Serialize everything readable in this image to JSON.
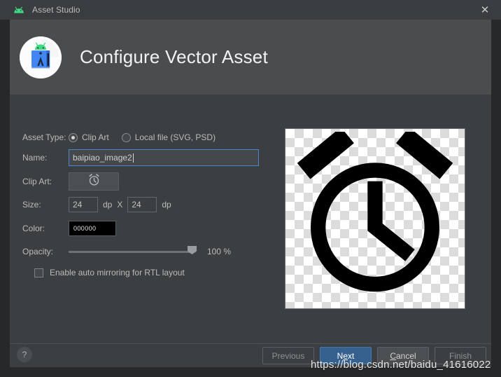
{
  "window": {
    "title": "Asset Studio",
    "app_icon": "android-head-icon",
    "close_icon": "close-icon"
  },
  "header": {
    "logo_icon": "android-studio-asset-icon",
    "title": "Configure Vector Asset"
  },
  "form": {
    "asset_type": {
      "label": "Asset Type:",
      "options": [
        {
          "label": "Clip Art",
          "selected": true
        },
        {
          "label": "Local file (SVG, PSD)",
          "selected": false
        }
      ]
    },
    "name": {
      "label": "Name:",
      "value": "baipiao_image2",
      "placeholder": ""
    },
    "clip_art": {
      "label": "Clip Art:",
      "icon": "alarm-clock-icon"
    },
    "size": {
      "label": "Size:",
      "width": "24",
      "height": "24",
      "unit": "dp",
      "separator": "X"
    },
    "color": {
      "label": "Color:",
      "hex": "000000",
      "swatch": "#000000"
    },
    "opacity": {
      "label": "Opacity:",
      "value": "100 %",
      "percent": 100
    },
    "mirror": {
      "label": "Enable auto mirroring for RTL layout",
      "checked": false
    }
  },
  "preview": {
    "icon": "alarm-clock-icon",
    "icon_color": "#000000",
    "background": "checkerboard-transparency"
  },
  "footer": {
    "help_label": "?",
    "buttons": [
      {
        "label": "Previous",
        "state": "disabled",
        "mnemonic": ""
      },
      {
        "label": "Next",
        "state": "primary",
        "mnemonic": "x"
      },
      {
        "label": "Cancel",
        "state": "enabled",
        "mnemonic": "C"
      },
      {
        "label": "Finish",
        "state": "disabled",
        "mnemonic": ""
      }
    ]
  },
  "watermark": {
    "text": "https://blog.csdn.net/baidu_41616022"
  },
  "colors": {
    "dialog_bg": "#3c3f41",
    "header_bg": "#4a4c4e",
    "titlebar_bg": "#3a3d3f",
    "accent": "#4a88c7",
    "primary_button": "#36618f",
    "text": "#bbbbbb"
  }
}
